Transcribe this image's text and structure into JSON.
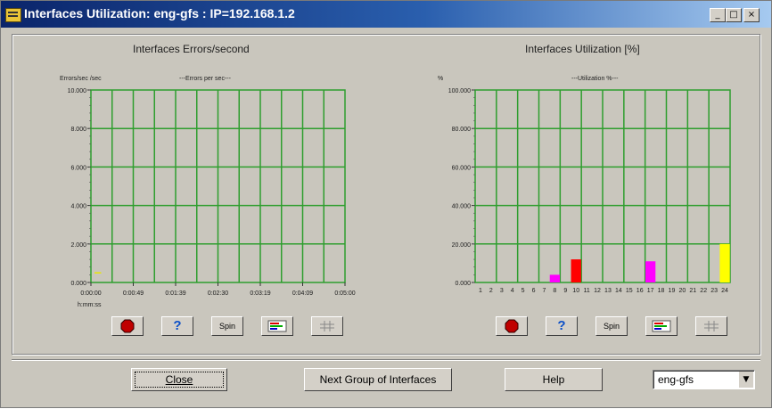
{
  "window": {
    "title": "Interfaces Utilization: eng-gfs : IP=192.168.1.2",
    "controls": {
      "minimize": "_",
      "maximize": "□",
      "close": "×"
    }
  },
  "errors_chart": {
    "title": "Interfaces Errors/second",
    "ylabel": "Errors/sec /sec",
    "legend": "---Errors per sec---",
    "xsublabel": "h:mm:ss"
  },
  "util_chart": {
    "title": "Interfaces Utilization [%]",
    "ylabel": "%",
    "legend": "---Utilization %---"
  },
  "toolbar": {
    "stop_icon": "stop-icon",
    "help_label": "?",
    "spin_label": "Spin",
    "legend_icon": "legend-icon",
    "grid_icon": "grid-icon"
  },
  "buttons": {
    "close": "Close",
    "next_group": "Next Group of Interfaces",
    "help": "Help"
  },
  "select": {
    "value": "eng-gfs"
  },
  "colors": {
    "grid": "#2e9e2e",
    "accent": "#0a246a"
  },
  "chart_data": [
    {
      "type": "line",
      "title": "Interfaces Errors/second",
      "ylabel": "Errors/sec /sec",
      "xlabel": "h:mm:ss",
      "y_ticks": [
        "0.000",
        "2.000",
        "4.000",
        "6.000",
        "8.000",
        "10.000"
      ],
      "ylim": [
        0,
        10
      ],
      "x_ticks": [
        "0:00:00",
        "0:00:49",
        "0:01:39",
        "0:02:30",
        "0:03:19",
        "0:04:09",
        "0:05:00"
      ],
      "series": [
        {
          "color": "#e8e800",
          "points": [
            [
              0,
              0.5
            ],
            [
              0.5,
              0.5
            ]
          ]
        }
      ],
      "grid": true
    },
    {
      "type": "bar",
      "title": "Interfaces Utilization [%]",
      "ylabel": "%",
      "y_ticks": [
        "0.000",
        "20.000",
        "40.000",
        "60.000",
        "80.000",
        "100.000"
      ],
      "ylim": [
        0,
        100
      ],
      "categories": [
        "1",
        "2",
        "3",
        "4",
        "5",
        "6",
        "7",
        "8",
        "9",
        "10",
        "11",
        "12",
        "13",
        "14",
        "15",
        "16",
        "17",
        "18",
        "19",
        "20",
        "21",
        "22",
        "23",
        "24"
      ],
      "values": [
        0,
        0,
        0,
        0,
        0,
        0,
        0,
        4,
        0,
        12,
        0,
        0,
        0,
        0,
        0,
        0,
        11,
        0,
        0,
        0,
        0,
        0,
        0,
        20
      ],
      "bar_colors": {
        "8": "#ff00ff",
        "10": "#ff0000",
        "17": "#ff00ff",
        "24": "#ffff00"
      },
      "grid": true
    }
  ]
}
